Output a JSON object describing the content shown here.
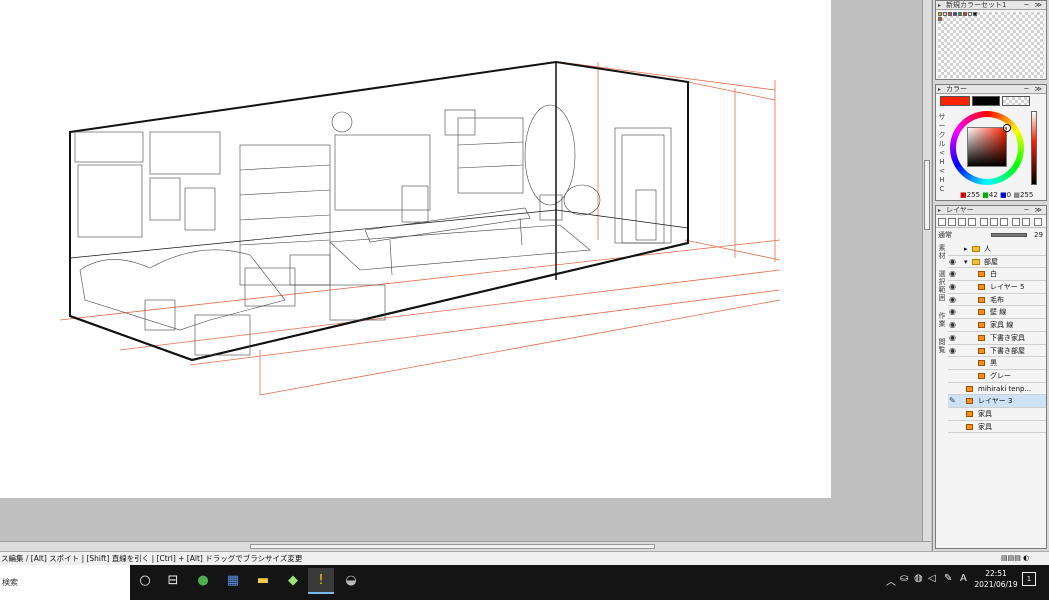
{
  "colors": {
    "accent_red": "#ff2200",
    "perspective_line": "#e2542e",
    "selection": "#cde3f5"
  },
  "swatch_panel": {
    "title": "新規カラーセット1"
  },
  "color_panel": {
    "title": "カラー",
    "side_tabs": [
      "サ",
      "ー",
      "ク",
      "ル",
      "<",
      "H",
      "<",
      "H",
      "C"
    ],
    "rgb": {
      "r": "255",
      "g": "42",
      "b": "0",
      "a": "255"
    },
    "main_color": "#ff2200",
    "sub_color": "#000000"
  },
  "layer_panel": {
    "title": "レイヤー",
    "blend_mode": "通常",
    "opacity": "29",
    "side_tabs": [
      "素材",
      "選択範囲",
      "作業",
      "閲覧"
    ],
    "layers": [
      {
        "name": "人",
        "type": "folder",
        "visible": false,
        "indent": 2,
        "expander": "▸"
      },
      {
        "name": "部屋",
        "type": "folder",
        "visible": true,
        "indent": 2,
        "expander": "▾"
      },
      {
        "name": "白",
        "type": "raster",
        "visible": true,
        "indent": 3
      },
      {
        "name": "レイヤー 5",
        "type": "raster",
        "visible": true,
        "indent": 3
      },
      {
        "name": "毛布",
        "type": "raster",
        "visible": true,
        "indent": 3
      },
      {
        "name": "壁 線",
        "type": "raster",
        "visible": true,
        "indent": 3
      },
      {
        "name": "家具 線",
        "type": "raster",
        "visible": true,
        "indent": 3
      },
      {
        "name": "下書き家具",
        "type": "raster",
        "visible": true,
        "indent": 3
      },
      {
        "name": "下書き部屋",
        "type": "raster",
        "visible": true,
        "indent": 3
      },
      {
        "name": "黒",
        "type": "raster",
        "visible": false,
        "indent": 3
      },
      {
        "name": "グレー",
        "type": "raster",
        "visible": false,
        "indent": 3
      },
      {
        "name": "mihiraki tenp...",
        "type": "raster",
        "visible": false,
        "indent": 1
      },
      {
        "name": "レイヤー 3",
        "type": "raster",
        "visible": false,
        "indent": 1,
        "selected": true
      },
      {
        "name": "家具",
        "type": "raster",
        "visible": false,
        "indent": 1
      },
      {
        "name": "家具",
        "type": "raster",
        "visible": false,
        "indent": 1
      }
    ]
  },
  "status_bar": {
    "text": "ス編集 / [Alt] スポイト | [Shift] 直線を引く | [Ctrl] + [Alt] ドラッグでブラシサイズ変更"
  },
  "taskbar": {
    "search_text": "検索",
    "time": "22:51",
    "date": "2021/06/19",
    "ime": "A"
  }
}
